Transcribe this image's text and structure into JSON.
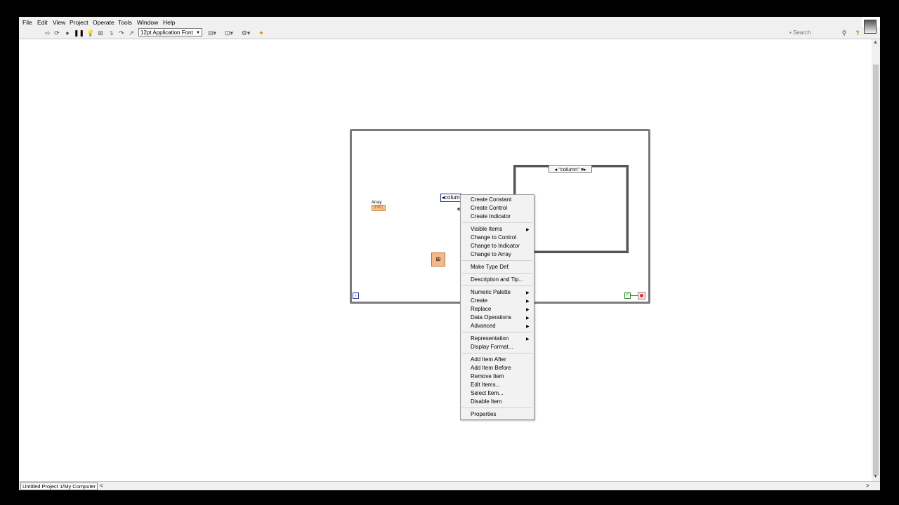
{
  "menubar": [
    "File",
    "Edit",
    "View",
    "Project",
    "Operate",
    "Tools",
    "Window",
    "Help"
  ],
  "toolbar": {
    "font_select": "12pt Application Font",
    "search_placeholder": "Search",
    "icons": [
      "run-arrow-icon",
      "run-continuously-icon",
      "abort-icon",
      "pause-icon",
      "highlight-execution-icon",
      "retain-wire-values-icon",
      "step-into-icon",
      "step-over-icon",
      "step-out-icon",
      "align-objects-icon",
      "distribute-objects-icon",
      "resize-objects-icon",
      "reorder-icon",
      "cleanup-diagram-icon",
      "search-icon",
      "help-icon"
    ]
  },
  "diagram": {
    "array_label": "Array",
    "array_term_text": "[DBL]",
    "enum_constant": "◂column",
    "case_selector": "◂ \"column\" ▾▸",
    "iteration_terminal": "i",
    "boolean_constant": "F"
  },
  "context_menu": [
    {
      "label": "Create Constant",
      "submenu": false
    },
    {
      "label": "Create Control",
      "submenu": false
    },
    {
      "label": "Create Indicator",
      "submenu": false
    },
    {
      "separator": true
    },
    {
      "label": "Visible Items",
      "submenu": true
    },
    {
      "label": "Change to Control",
      "submenu": false
    },
    {
      "label": "Change to Indicator",
      "submenu": false
    },
    {
      "label": "Change to Array",
      "submenu": false
    },
    {
      "separator": true
    },
    {
      "label": "Make Type Def.",
      "submenu": false
    },
    {
      "separator": true
    },
    {
      "label": "Description and Tip...",
      "submenu": false
    },
    {
      "separator": true
    },
    {
      "label": "Numeric Palette",
      "submenu": true
    },
    {
      "label": "Create",
      "submenu": true
    },
    {
      "label": "Replace",
      "submenu": true
    },
    {
      "label": "Data Operations",
      "submenu": true
    },
    {
      "label": "Advanced",
      "submenu": true
    },
    {
      "separator": true
    },
    {
      "label": "Representation",
      "submenu": true
    },
    {
      "label": "Display Format...",
      "submenu": false
    },
    {
      "separator": true
    },
    {
      "label": "Add Item After",
      "submenu": false
    },
    {
      "label": "Add Item Before",
      "submenu": false
    },
    {
      "label": "Remove Item",
      "submenu": false
    },
    {
      "label": "Edit Items...",
      "submenu": false
    },
    {
      "label": "Select Item...",
      "submenu": false
    },
    {
      "label": "Disable Item",
      "submenu": false
    },
    {
      "separator": true
    },
    {
      "label": "Properties",
      "submenu": false
    }
  ],
  "status_bar": {
    "project_path": "Untitled Project 1/My Computer"
  }
}
